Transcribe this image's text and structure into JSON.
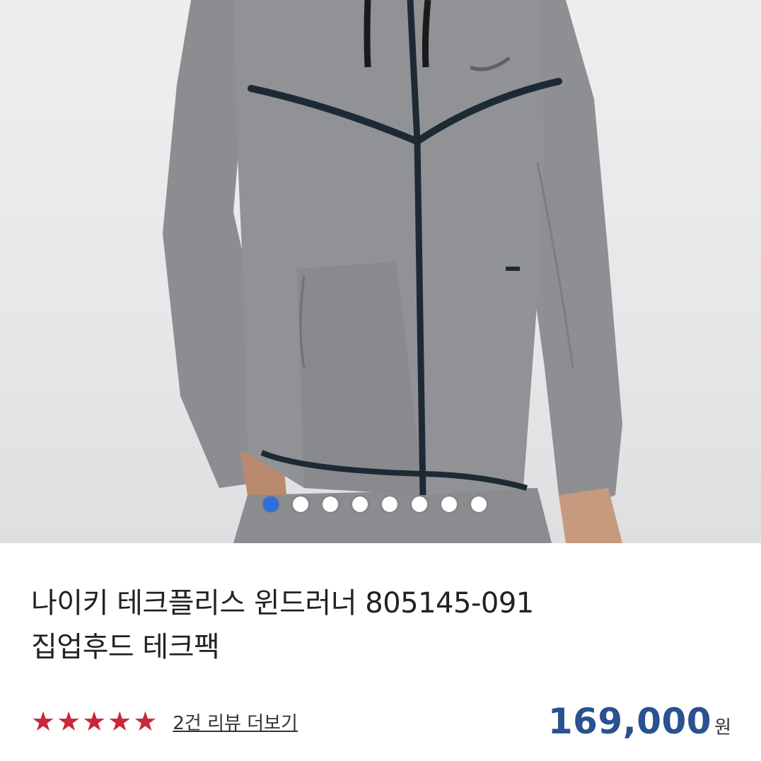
{
  "product": {
    "title_line1": "나이키 테크플리스 윈드러너 805145-091",
    "title_line2": "집업후드 테크팩",
    "review_link": "2건 리뷰 더보기",
    "rating": 5,
    "rating_max": 5,
    "star_glyph": "★",
    "star_color": "#c8283a",
    "price": "169,000",
    "price_unit": "원"
  },
  "gallery": {
    "image_count": 8,
    "active_index": 0,
    "active_dot_color": "#2f6fdc"
  }
}
